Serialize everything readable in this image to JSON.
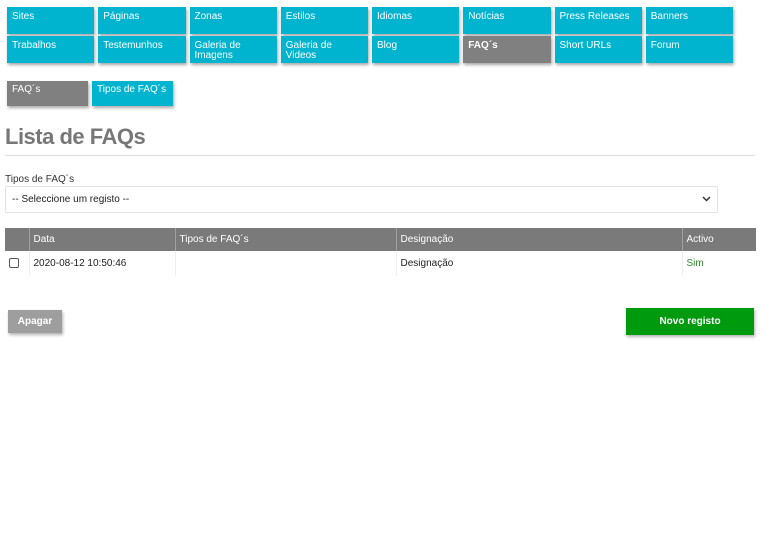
{
  "nav": {
    "row1": [
      "Sites",
      "Páginas",
      "Zonas",
      "Estilos",
      "Idiomas",
      "Notícias",
      "Press Releases",
      "Banners"
    ],
    "row2": [
      "Trabalhos",
      "Testemunhos",
      "Galeria de Imagens",
      "Galeria de Videos",
      "Blog",
      "FAQ´s",
      "Short URLs",
      "Forum"
    ],
    "active": "FAQ´s"
  },
  "subnav": [
    "FAQ´s",
    "Tipos de FAQ´s"
  ],
  "page": {
    "title": "Lista de FAQs"
  },
  "filter": {
    "label": "Tipos de FAQ´s",
    "selected": "-- Seleccione um registo --"
  },
  "table": {
    "columns": [
      "",
      "Data",
      "Tipos de FAQ´s",
      "Designação",
      "Activo"
    ],
    "rows": [
      {
        "date": "2020-08-12 10:50:46",
        "type": "",
        "designation": "Designação",
        "active": "Sim"
      }
    ]
  },
  "buttons": {
    "delete": "Apagar",
    "new": "Novo registo"
  },
  "colors": {
    "tile": "#00b4cf",
    "tile_active": "#808080",
    "header": "#7a7a7a",
    "primary": "#009a0e",
    "secondary": "#9e9e9e"
  }
}
